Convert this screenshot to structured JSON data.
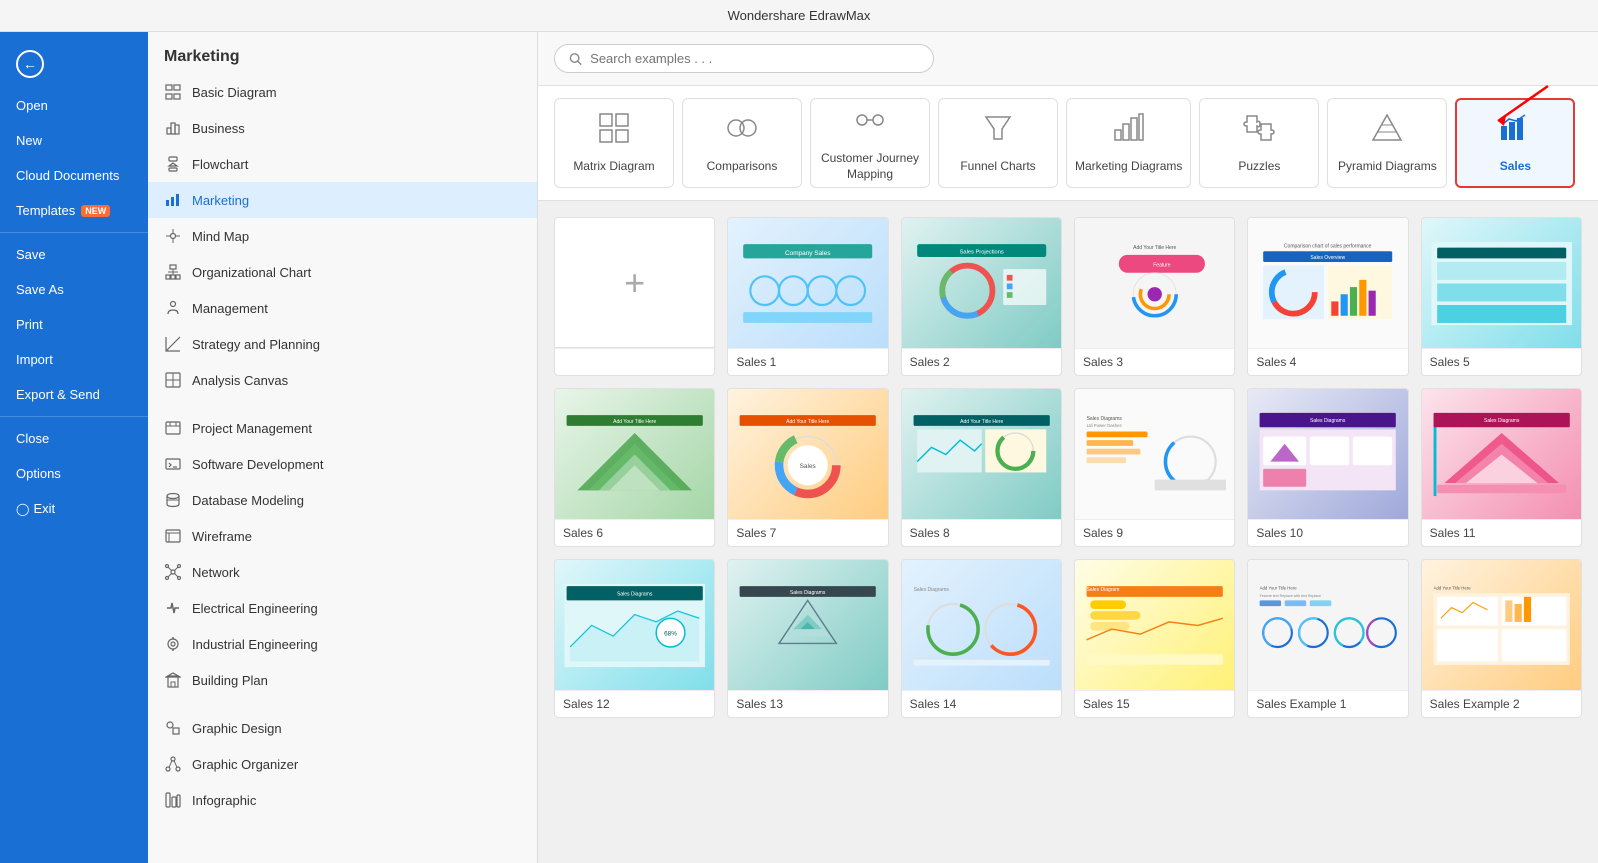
{
  "app": {
    "title": "Wondershare EdrawMax"
  },
  "sidebar": {
    "back_label": "",
    "items": [
      {
        "id": "open",
        "label": "Open"
      },
      {
        "id": "new",
        "label": "New"
      },
      {
        "id": "cloud",
        "label": "Cloud Documents"
      },
      {
        "id": "templates",
        "label": "Templates",
        "badge": "NEW"
      },
      {
        "id": "save",
        "label": "Save"
      },
      {
        "id": "save-as",
        "label": "Save As"
      },
      {
        "id": "print",
        "label": "Print"
      },
      {
        "id": "import",
        "label": "Import"
      },
      {
        "id": "export",
        "label": "Export & Send"
      },
      {
        "id": "close",
        "label": "Close"
      },
      {
        "id": "options",
        "label": "Options"
      },
      {
        "id": "exit",
        "label": "Exit"
      }
    ]
  },
  "nav": {
    "section_title": "Marketing",
    "items": [
      {
        "id": "basic",
        "label": "Basic Diagram"
      },
      {
        "id": "business",
        "label": "Business"
      },
      {
        "id": "flowchart",
        "label": "Flowchart"
      },
      {
        "id": "marketing",
        "label": "Marketing",
        "active": true
      },
      {
        "id": "mindmap",
        "label": "Mind Map"
      },
      {
        "id": "orgchart",
        "label": "Organizational Chart"
      },
      {
        "id": "management",
        "label": "Management"
      },
      {
        "id": "strategy",
        "label": "Strategy and Planning"
      },
      {
        "id": "analysis",
        "label": "Analysis Canvas"
      },
      {
        "id": "project",
        "label": "Project Management"
      },
      {
        "id": "software",
        "label": "Software Development"
      },
      {
        "id": "database",
        "label": "Database Modeling"
      },
      {
        "id": "wireframe",
        "label": "Wireframe"
      },
      {
        "id": "network",
        "label": "Network"
      },
      {
        "id": "electrical",
        "label": "Electrical Engineering"
      },
      {
        "id": "industrial",
        "label": "Industrial Engineering"
      },
      {
        "id": "building",
        "label": "Building Plan"
      },
      {
        "id": "graphic",
        "label": "Graphic Design"
      },
      {
        "id": "organizer",
        "label": "Graphic Organizer"
      },
      {
        "id": "infographic",
        "label": "Infographic"
      }
    ]
  },
  "search": {
    "placeholder": "Search examples . . ."
  },
  "categories": [
    {
      "id": "matrix",
      "label": "Matrix Diagram",
      "icon": "matrix"
    },
    {
      "id": "comparisons",
      "label": "Comparisons",
      "icon": "comparisons"
    },
    {
      "id": "journey",
      "label": "Customer Journey\nMapping",
      "icon": "journey"
    },
    {
      "id": "funnel",
      "label": "Funnel Charts",
      "icon": "funnel"
    },
    {
      "id": "marketing",
      "label": "Marketing Diagrams",
      "icon": "marketing"
    },
    {
      "id": "puzzles",
      "label": "Puzzles",
      "icon": "puzzles"
    },
    {
      "id": "pyramid",
      "label": "Pyramid Diagrams",
      "icon": "pyramid"
    },
    {
      "id": "sales",
      "label": "Sales",
      "icon": "sales",
      "selected": true,
      "highlighted": true
    }
  ],
  "templates": [
    {
      "id": "new",
      "label": "",
      "type": "new"
    },
    {
      "id": "sales1",
      "label": "Sales 1",
      "color": "blue"
    },
    {
      "id": "sales2",
      "label": "Sales 2",
      "color": "teal"
    },
    {
      "id": "sales3",
      "label": "Sales 3",
      "color": "orange"
    },
    {
      "id": "sales4",
      "label": "Sales 4",
      "color": "purple"
    },
    {
      "id": "sales5",
      "label": "Sales 5",
      "color": "cyan"
    },
    {
      "id": "sales6",
      "label": "Sales 6",
      "color": "green"
    },
    {
      "id": "sales7",
      "label": "Sales 7",
      "color": "orange"
    },
    {
      "id": "sales8",
      "label": "Sales 8",
      "color": "teal"
    },
    {
      "id": "sales9",
      "label": "Sales 9",
      "color": "blue"
    },
    {
      "id": "sales10",
      "label": "Sales 10",
      "color": "indigo"
    },
    {
      "id": "sales11",
      "label": "Sales 11",
      "color": "pink"
    },
    {
      "id": "sales12",
      "label": "Sales 12",
      "color": "cyan"
    },
    {
      "id": "sales13",
      "label": "Sales 13",
      "color": "teal"
    },
    {
      "id": "sales14",
      "label": "Sales 14",
      "color": "blue"
    },
    {
      "id": "sales15",
      "label": "Sales 15",
      "color": "yellow"
    },
    {
      "id": "example1",
      "label": "Sales Example 1",
      "color": "purple"
    },
    {
      "id": "example2",
      "label": "Sales Example 2",
      "color": "orange"
    }
  ]
}
